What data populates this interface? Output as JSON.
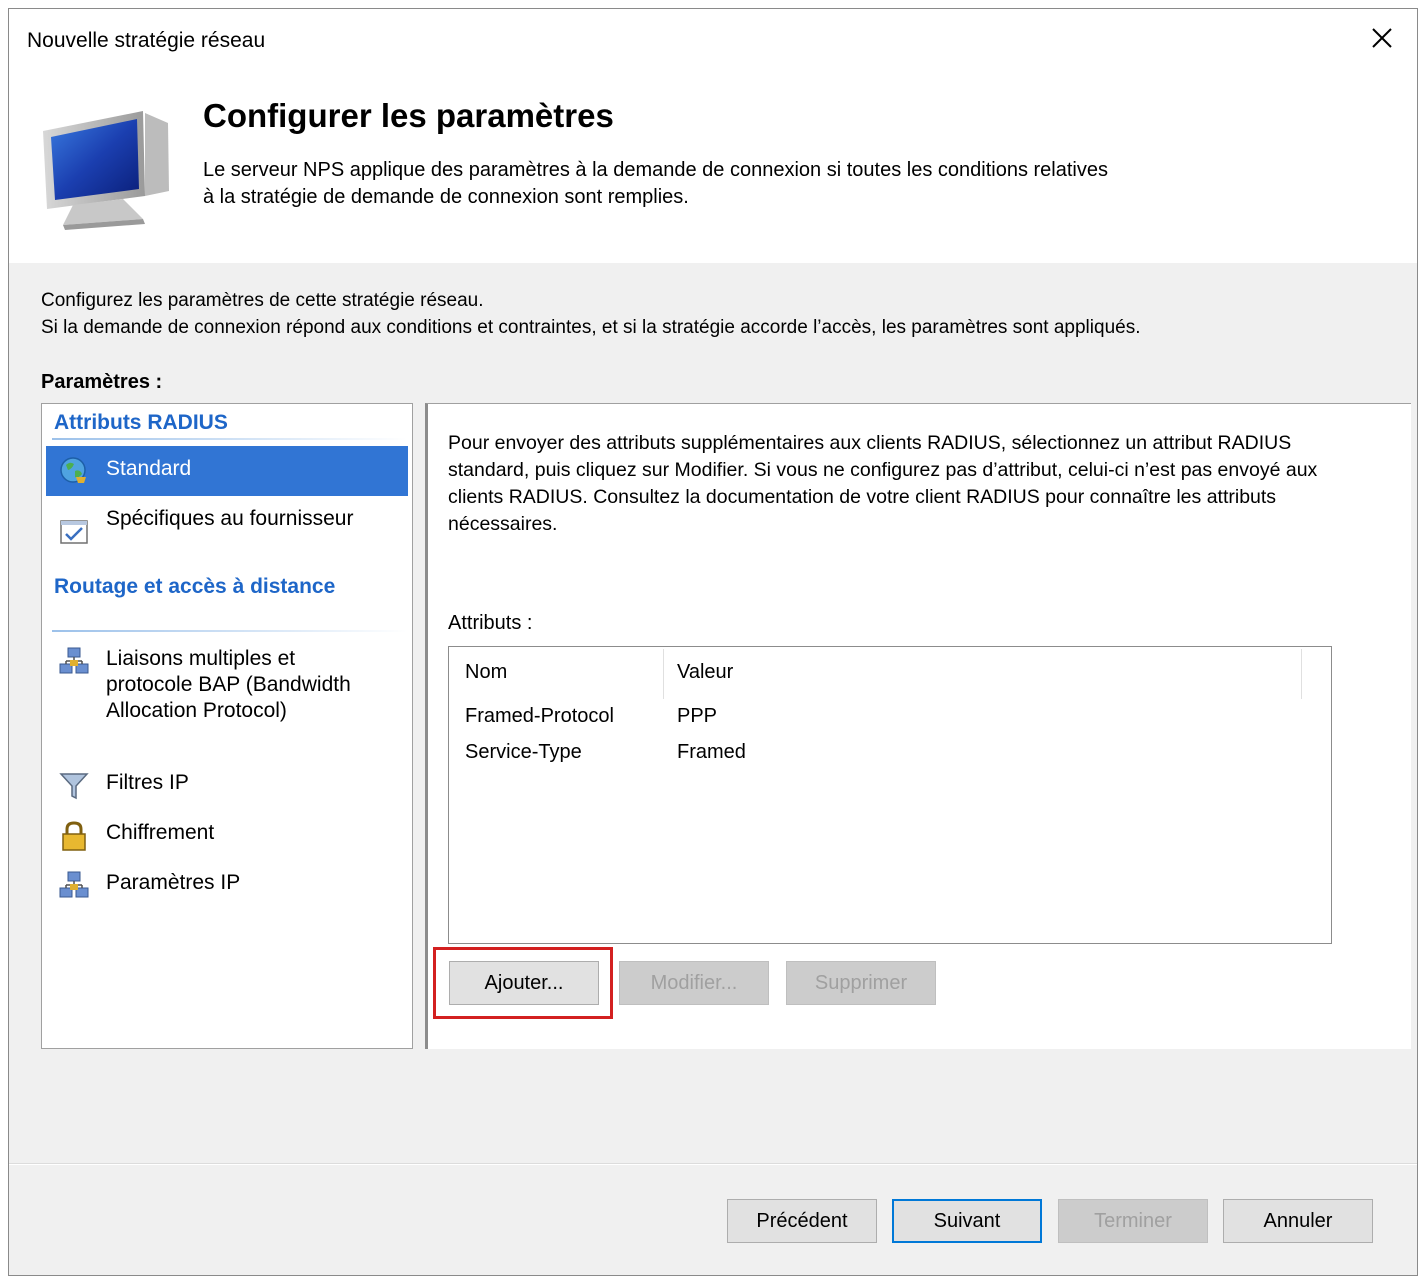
{
  "window": {
    "title": "Nouvelle stratégie réseau"
  },
  "header": {
    "title": "Configurer les paramètres",
    "description": "Le serveur NPS applique des paramètres à la demande de connexion si toutes les conditions relatives\nà la stratégie de demande de connexion sont remplies."
  },
  "intro": "Configurez les paramètres de cette stratégie réseau.\nSi la demande de connexion répond aux conditions et contraintes, et si la stratégie accorde l’accès, les paramètres sont appliqués.",
  "params_label": "Paramètres :",
  "sidebar": {
    "section1": "Attributs RADIUS",
    "item_standard": "Standard",
    "item_vendor": "Spécifiques au fournisseur",
    "section2": "Routage et accès à distance",
    "item_multilink": "Liaisons multiples et protocole BAP (Bandwidth Allocation Protocol)",
    "item_ipfilters": "Filtres IP",
    "item_encryption": "Chiffrement",
    "item_ipsettings": "Paramètres IP"
  },
  "main": {
    "description": "Pour envoyer des attributs supplémentaires aux clients RADIUS, sélectionnez un attribut RADIUS standard, puis cliquez sur Modifier. Si vous ne configurez pas d’attribut, celui-ci n’est pas envoyé aux clients RADIUS. Consultez la documentation de votre client RADIUS pour connaître les attributs nécessaires.",
    "attributes_label": "Attributs :",
    "columns": [
      "Nom",
      "Valeur"
    ],
    "rows": [
      {
        "name": "Framed-Protocol",
        "value": "PPP"
      },
      {
        "name": "Service-Type",
        "value": "Framed"
      }
    ],
    "add_button": "Ajouter...",
    "edit_button": "Modifier...",
    "delete_button": "Supprimer"
  },
  "footer": {
    "prev": "Précédent",
    "next": "Suivant",
    "finish": "Terminer",
    "cancel": "Annuler"
  },
  "colors": {
    "accent": "#3175d4",
    "section_heading": "#1e66c8",
    "highlight": "#d32020"
  }
}
